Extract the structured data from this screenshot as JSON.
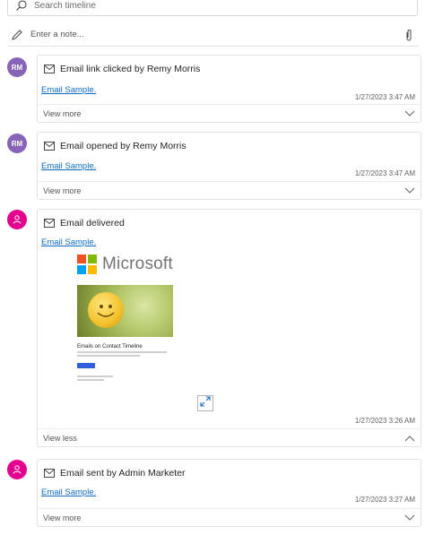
{
  "search": {
    "placeholder": "Search timeline"
  },
  "note": {
    "placeholder": "Enter a note..."
  },
  "activities": [
    {
      "avatar": "RM",
      "title": "Email link clicked by Remy Morris",
      "link": "Email Sample.",
      "timestamp": "1/27/2023 3:47 AM",
      "toggle": "View more"
    },
    {
      "avatar": "RM",
      "title": "Email opened by Remy Morris",
      "link": "Email Sample.",
      "timestamp": "1/27/2023 3:47 AM",
      "toggle": "View more"
    },
    {
      "avatar_icon": "system-user-icon",
      "title": "Email delivered",
      "link": "Email Sample.",
      "preview": {
        "logo_text": "Microsoft",
        "heading": "Emails on Contact Timeline"
      },
      "timestamp": "1/27/2023 3:26 AM",
      "toggle": "View less"
    },
    {
      "avatar_icon": "system-user-icon",
      "title": "Email sent by Admin Marketer",
      "link": "Email Sample.",
      "timestamp": "1/27/2023 3:27 AM",
      "toggle": "View more"
    }
  ],
  "colors": {
    "link": "#0f6cbd",
    "avatar_rm": "#8764b8",
    "avatar_system": "#e3008c",
    "ms_red": "#f25022",
    "ms_green": "#7fba00",
    "ms_blue": "#00a4ef",
    "ms_yellow": "#ffb900"
  }
}
